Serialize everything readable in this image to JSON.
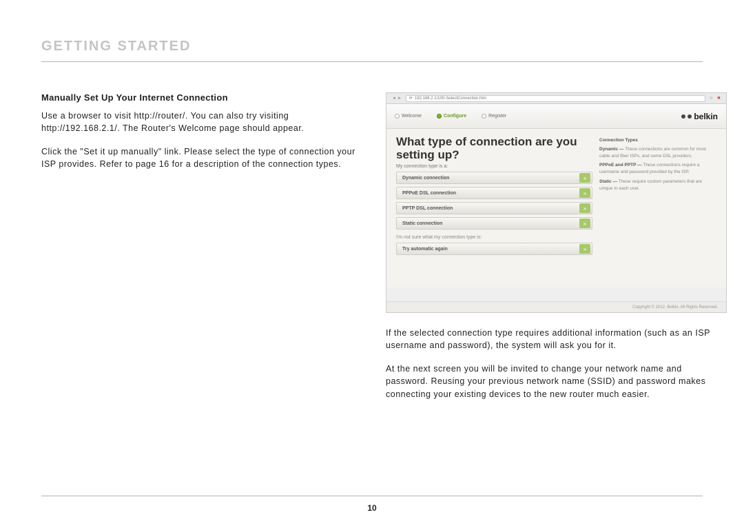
{
  "chapter": "GETTING STARTED",
  "subheading": "Manually Set Up Your Internet Connection",
  "p1": "Use a browser to visit http://router/. You can also try visiting http://192.168.2.1/. The Router's Welcome page should appear.",
  "p2": "Click the \"Set it up manually\" link. Please select the type of connection your ISP provides. Refer to page 16 for a description of the connection types.",
  "p3": "If the selected connection type requires additional information (such as an ISP username and password), the system will ask you for it.",
  "p4": "At the next screen you will be invited to change your network name and password. Reusing your previous network name (SSID) and password makes connecting your existing devices to the new router much easier.",
  "pageNumber": "10",
  "screenshot": {
    "url": "192.168.2.1/100-SelectConnection.htm",
    "steps": {
      "s1": "Welcome",
      "s2": "Configure",
      "s3": "Register"
    },
    "brand": "belkin",
    "h1": "What type of connection are you setting up?",
    "sub1": "My connection type is a:",
    "options": [
      "Dynamic connection",
      "PPPoE DSL connection",
      "PPTP DSL connection",
      "Static connection"
    ],
    "noteLabel": "I'm not sure what my connection type is:",
    "tryAgain": "Try automatic again",
    "side": {
      "title": "Connection Types",
      "l1b": "Dynamic —",
      "l1": " These connections are common for most cable and fiber ISPs, and some DSL providers.",
      "l2b": "PPPoE and PPTP —",
      "l2": " These connections require a username and password provided by the ISP.",
      "l3b": "Static —",
      "l3": " These require custom parameters that are unique to each user."
    },
    "footer": "Copyright © 2012, Belkin. All Rights Reserved."
  }
}
